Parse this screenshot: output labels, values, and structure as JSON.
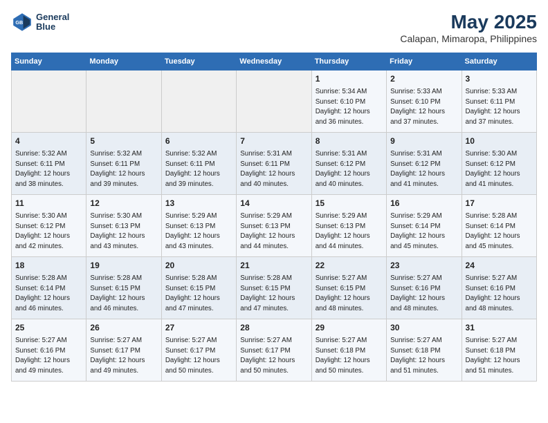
{
  "header": {
    "logo_line1": "General",
    "logo_line2": "Blue",
    "main_title": "May 2025",
    "subtitle": "Calapan, Mimaropa, Philippines"
  },
  "days_of_week": [
    "Sunday",
    "Monday",
    "Tuesday",
    "Wednesday",
    "Thursday",
    "Friday",
    "Saturday"
  ],
  "weeks": [
    [
      {
        "day": "",
        "info": ""
      },
      {
        "day": "",
        "info": ""
      },
      {
        "day": "",
        "info": ""
      },
      {
        "day": "",
        "info": ""
      },
      {
        "day": "1",
        "info": "Sunrise: 5:34 AM\nSunset: 6:10 PM\nDaylight: 12 hours\nand 36 minutes."
      },
      {
        "day": "2",
        "info": "Sunrise: 5:33 AM\nSunset: 6:10 PM\nDaylight: 12 hours\nand 37 minutes."
      },
      {
        "day": "3",
        "info": "Sunrise: 5:33 AM\nSunset: 6:11 PM\nDaylight: 12 hours\nand 37 minutes."
      }
    ],
    [
      {
        "day": "4",
        "info": "Sunrise: 5:32 AM\nSunset: 6:11 PM\nDaylight: 12 hours\nand 38 minutes."
      },
      {
        "day": "5",
        "info": "Sunrise: 5:32 AM\nSunset: 6:11 PM\nDaylight: 12 hours\nand 39 minutes."
      },
      {
        "day": "6",
        "info": "Sunrise: 5:32 AM\nSunset: 6:11 PM\nDaylight: 12 hours\nand 39 minutes."
      },
      {
        "day": "7",
        "info": "Sunrise: 5:31 AM\nSunset: 6:11 PM\nDaylight: 12 hours\nand 40 minutes."
      },
      {
        "day": "8",
        "info": "Sunrise: 5:31 AM\nSunset: 6:12 PM\nDaylight: 12 hours\nand 40 minutes."
      },
      {
        "day": "9",
        "info": "Sunrise: 5:31 AM\nSunset: 6:12 PM\nDaylight: 12 hours\nand 41 minutes."
      },
      {
        "day": "10",
        "info": "Sunrise: 5:30 AM\nSunset: 6:12 PM\nDaylight: 12 hours\nand 41 minutes."
      }
    ],
    [
      {
        "day": "11",
        "info": "Sunrise: 5:30 AM\nSunset: 6:12 PM\nDaylight: 12 hours\nand 42 minutes."
      },
      {
        "day": "12",
        "info": "Sunrise: 5:30 AM\nSunset: 6:13 PM\nDaylight: 12 hours\nand 43 minutes."
      },
      {
        "day": "13",
        "info": "Sunrise: 5:29 AM\nSunset: 6:13 PM\nDaylight: 12 hours\nand 43 minutes."
      },
      {
        "day": "14",
        "info": "Sunrise: 5:29 AM\nSunset: 6:13 PM\nDaylight: 12 hours\nand 44 minutes."
      },
      {
        "day": "15",
        "info": "Sunrise: 5:29 AM\nSunset: 6:13 PM\nDaylight: 12 hours\nand 44 minutes."
      },
      {
        "day": "16",
        "info": "Sunrise: 5:29 AM\nSunset: 6:14 PM\nDaylight: 12 hours\nand 45 minutes."
      },
      {
        "day": "17",
        "info": "Sunrise: 5:28 AM\nSunset: 6:14 PM\nDaylight: 12 hours\nand 45 minutes."
      }
    ],
    [
      {
        "day": "18",
        "info": "Sunrise: 5:28 AM\nSunset: 6:14 PM\nDaylight: 12 hours\nand 46 minutes."
      },
      {
        "day": "19",
        "info": "Sunrise: 5:28 AM\nSunset: 6:15 PM\nDaylight: 12 hours\nand 46 minutes."
      },
      {
        "day": "20",
        "info": "Sunrise: 5:28 AM\nSunset: 6:15 PM\nDaylight: 12 hours\nand 47 minutes."
      },
      {
        "day": "21",
        "info": "Sunrise: 5:28 AM\nSunset: 6:15 PM\nDaylight: 12 hours\nand 47 minutes."
      },
      {
        "day": "22",
        "info": "Sunrise: 5:27 AM\nSunset: 6:15 PM\nDaylight: 12 hours\nand 48 minutes."
      },
      {
        "day": "23",
        "info": "Sunrise: 5:27 AM\nSunset: 6:16 PM\nDaylight: 12 hours\nand 48 minutes."
      },
      {
        "day": "24",
        "info": "Sunrise: 5:27 AM\nSunset: 6:16 PM\nDaylight: 12 hours\nand 48 minutes."
      }
    ],
    [
      {
        "day": "25",
        "info": "Sunrise: 5:27 AM\nSunset: 6:16 PM\nDaylight: 12 hours\nand 49 minutes."
      },
      {
        "day": "26",
        "info": "Sunrise: 5:27 AM\nSunset: 6:17 PM\nDaylight: 12 hours\nand 49 minutes."
      },
      {
        "day": "27",
        "info": "Sunrise: 5:27 AM\nSunset: 6:17 PM\nDaylight: 12 hours\nand 50 minutes."
      },
      {
        "day": "28",
        "info": "Sunrise: 5:27 AM\nSunset: 6:17 PM\nDaylight: 12 hours\nand 50 minutes."
      },
      {
        "day": "29",
        "info": "Sunrise: 5:27 AM\nSunset: 6:18 PM\nDaylight: 12 hours\nand 50 minutes."
      },
      {
        "day": "30",
        "info": "Sunrise: 5:27 AM\nSunset: 6:18 PM\nDaylight: 12 hours\nand 51 minutes."
      },
      {
        "day": "31",
        "info": "Sunrise: 5:27 AM\nSunset: 6:18 PM\nDaylight: 12 hours\nand 51 minutes."
      }
    ]
  ]
}
